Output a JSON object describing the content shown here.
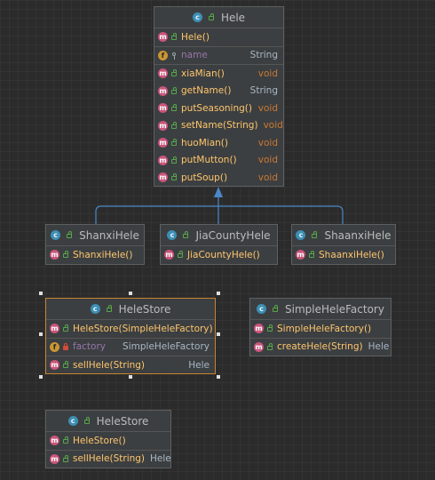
{
  "colors": {
    "background": "#2b2b2b",
    "box": "#3c3f41",
    "method": "#ffc66d",
    "field": "#9876aa",
    "void": "#cc7832",
    "arrow": "#4a88c7",
    "selection": "#c7842f"
  },
  "hele": {
    "name": "Hele",
    "constructor": "Hele()",
    "field": {
      "name": "name",
      "type": "String"
    },
    "methods": [
      {
        "name": "xiaMian()",
        "type": "void"
      },
      {
        "name": "getName()",
        "type": "String"
      },
      {
        "name": "putSeasoning()",
        "type": "void"
      },
      {
        "name": "setName(String)",
        "type": "void"
      },
      {
        "name": "huoMian()",
        "type": "void"
      },
      {
        "name": "putMutton()",
        "type": "void"
      },
      {
        "name": "putSoup()",
        "type": "void"
      }
    ]
  },
  "shanxi": {
    "name": "ShanxiHele",
    "constructor": "ShanxiHele()"
  },
  "jiacounty": {
    "name": "JiaCountyHele",
    "constructor": "JiaCountyHele()"
  },
  "shaanxi": {
    "name": "ShaanxiHele",
    "constructor": "ShaanxiHele()"
  },
  "store1": {
    "name": "HeleStore",
    "constructor": "HeleStore(SimpleHeleFactory)",
    "field": {
      "name": "factory",
      "type": "SimpleHeleFactory"
    },
    "method": {
      "name": "sellHele(String)",
      "type": "Hele"
    }
  },
  "factory": {
    "name": "SimpleHeleFactory",
    "constructor": "SimpleHeleFactory()",
    "method": {
      "name": "createHele(String)",
      "type": "Hele"
    }
  },
  "store2": {
    "name": "HeleStore",
    "constructor": "HeleStore()",
    "method": {
      "name": "sellHele(String)",
      "type": "Hele"
    }
  }
}
